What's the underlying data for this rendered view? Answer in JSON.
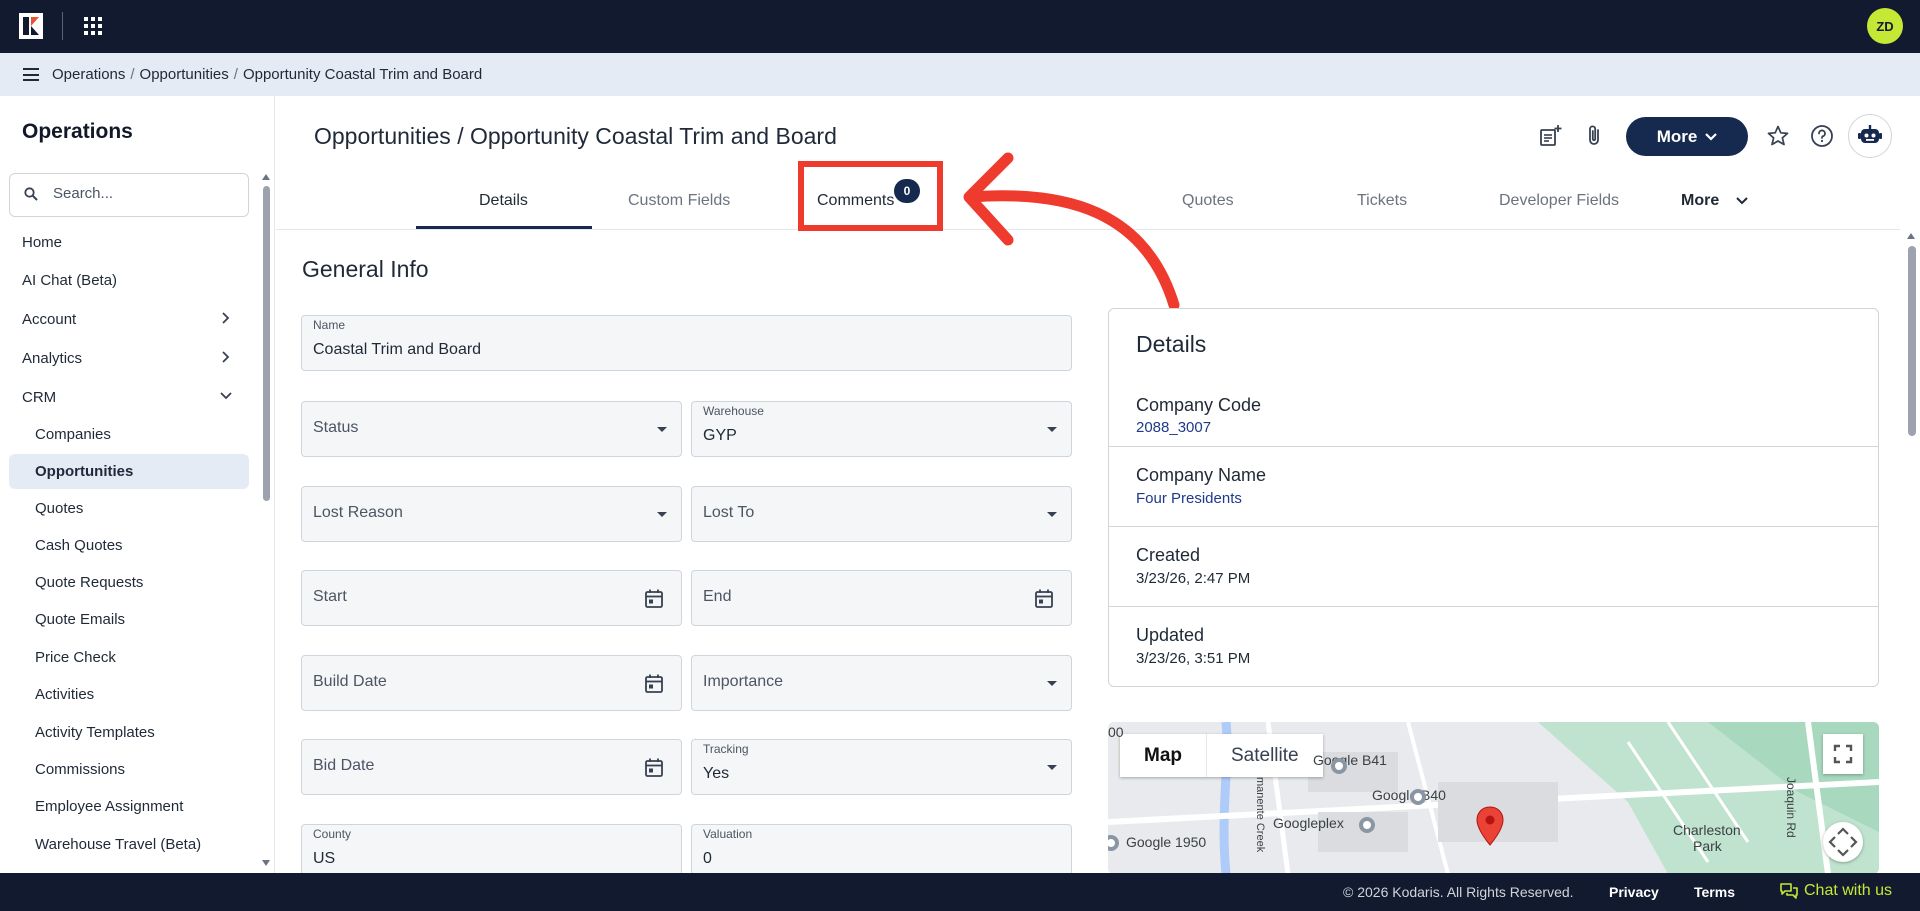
{
  "colors": {
    "topbar": "#111a2e",
    "accent": "#162a4f",
    "avatar": "#c5e836",
    "highlight": "#ef3b2d",
    "crumbbar": "#e4ebf5"
  },
  "topbar": {
    "avatar_initials": "ZD",
    "icons": [
      "kodaris-logo-icon",
      "apps-grid-icon"
    ]
  },
  "breadcrumb": {
    "items": [
      "Operations",
      "Opportunities",
      "Opportunity Coastal Trim and Board"
    ],
    "separator": "/"
  },
  "sidebar": {
    "title": "Operations",
    "search_placeholder": "Search...",
    "items": {
      "home": "Home",
      "ai_chat": "AI Chat (Beta)",
      "account": "Account",
      "analytics": "Analytics",
      "crm": "CRM"
    },
    "crm_children": [
      "Companies",
      "Opportunities",
      "Quotes",
      "Cash Quotes",
      "Quote Requests",
      "Quote Emails",
      "Price Check",
      "Activities",
      "Activity Templates",
      "Commissions",
      "Employee Assignment",
      "Warehouse Travel (Beta)"
    ],
    "active_item": "Opportunities"
  },
  "header": {
    "title": "Opportunities / Opportunity Coastal Trim and Board",
    "more_label": "More",
    "icons": [
      "add-note-icon",
      "attachment-icon",
      "star-icon",
      "help-icon",
      "bot-icon"
    ]
  },
  "tabs": {
    "details": "Details",
    "custom_fields": "Custom Fields",
    "comments": "Comments",
    "comments_count": "0",
    "quotes": "Quotes",
    "tickets": "Tickets",
    "developer_fields": "Developer Fields",
    "more": "More",
    "active": "Details"
  },
  "general_info": {
    "title": "General Info",
    "name": {
      "label": "Name",
      "value": "Coastal Trim and Board"
    },
    "status": {
      "placeholder": "Status"
    },
    "warehouse": {
      "label": "Warehouse",
      "value": "GYP"
    },
    "lost_reason": {
      "placeholder": "Lost Reason"
    },
    "lost_to": {
      "placeholder": "Lost To"
    },
    "start": {
      "placeholder": "Start"
    },
    "end": {
      "placeholder": "End"
    },
    "build_date": {
      "placeholder": "Build Date"
    },
    "importance": {
      "placeholder": "Importance"
    },
    "bid_date": {
      "placeholder": "Bid Date"
    },
    "tracking": {
      "label": "Tracking",
      "value": "Yes"
    },
    "county": {
      "label": "County",
      "value": "US"
    },
    "valuation": {
      "label": "Valuation",
      "value": "0"
    }
  },
  "details_card": {
    "title": "Details",
    "rows": [
      {
        "label": "Company Code",
        "value": "2088_3007"
      },
      {
        "label": "Company Name",
        "value": "Four Presidents"
      },
      {
        "label": "Created",
        "value": "3/23/26, 2:47 PM"
      },
      {
        "label": "Updated",
        "value": "3/23/26, 3:51 PM"
      }
    ]
  },
  "map": {
    "toggle": [
      "Map",
      "Satellite"
    ],
    "labels": [
      "Google B41",
      "Google B40",
      "Googleplex",
      "Google 1950",
      "Charleston",
      "Park",
      "Joaquin Rd",
      "manente Creek",
      "00"
    ]
  },
  "footer": {
    "copyright": "© 2026 Kodaris. All Rights Reserved.",
    "privacy": "Privacy",
    "terms": "Terms",
    "chat": "Chat with us"
  }
}
